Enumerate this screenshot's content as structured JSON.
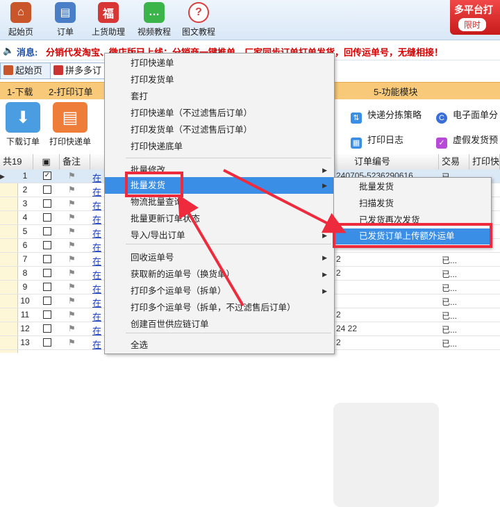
{
  "toolbar": {
    "buttons": [
      {
        "label": "起始页",
        "icon": "home-icon",
        "color": "#c9562a",
        "glyph": "⌂"
      },
      {
        "label": "订单",
        "icon": "cart-icon",
        "color": "#4a7fc8",
        "glyph": "🛒"
      },
      {
        "label": "上货助理",
        "icon": "gift-icon",
        "color": "#d83535",
        "glyph": "福"
      },
      {
        "label": "视频教程",
        "icon": "chat-icon",
        "color": "#3bb54a",
        "glyph": "…"
      },
      {
        "label": "图文教程",
        "icon": "help-icon",
        "color": "#d84040",
        "glyph": "?"
      }
    ],
    "promo_line1": "多平台打",
    "promo_line2": "限时"
  },
  "message": {
    "speaker_glyph": "🔈",
    "label": "消息:",
    "text": "分销代发淘宝、微店版已上线：分销商一键推单，厂家同步订单打单发货，回传运单号，无缝相接！"
  },
  "tabs": [
    {
      "label": "起始页"
    },
    {
      "label": "拼多多订"
    }
  ],
  "steps": [
    "1-下载",
    "2-打印订单",
    "5-功能模块"
  ],
  "functions": {
    "download_label": "下载订单",
    "print_label": "打印快递单",
    "links": [
      "快递分拣策略",
      "电子面单分",
      "打印日志",
      "虚假发货预"
    ]
  },
  "grid": {
    "headers": [
      "共19",
      "▣",
      "备注",
      "订单编号",
      "交易",
      "打印快"
    ],
    "link_text": "在",
    "rows": [
      {
        "n": "1",
        "checked": true,
        "oid": "240705-5236290616",
        "status": "已"
      },
      {
        "n": "2",
        "checked": false,
        "oid": "",
        "status": ""
      },
      {
        "n": "3",
        "checked": false,
        "oid": "",
        "status": ""
      },
      {
        "n": "4",
        "checked": false,
        "oid": "",
        "status": ""
      },
      {
        "n": "5",
        "checked": false,
        "oid": "",
        "status": ""
      },
      {
        "n": "6",
        "checked": false,
        "oid": "",
        "status": ""
      },
      {
        "n": "7",
        "checked": false,
        "oid": "2",
        "status": "已..."
      },
      {
        "n": "8",
        "checked": false,
        "oid": "2",
        "status": "已..."
      },
      {
        "n": "9",
        "checked": false,
        "oid": "",
        "status": "已..."
      },
      {
        "n": "10",
        "checked": false,
        "oid": "",
        "status": "已..."
      },
      {
        "n": "11",
        "checked": false,
        "oid": "2",
        "status": "已..."
      },
      {
        "n": "12",
        "checked": false,
        "oid": "24                    22",
        "status": "已..."
      },
      {
        "n": "13",
        "checked": false,
        "oid": "2",
        "status": "已..."
      }
    ]
  },
  "menu": {
    "items": [
      {
        "label": "打印快递单",
        "arrow": false
      },
      {
        "label": "打印发货单",
        "arrow": false
      },
      {
        "label": "套打",
        "arrow": false
      },
      {
        "label": "打印快递单（不过滤售后订单）",
        "arrow": false
      },
      {
        "label": "打印发货单（不过滤售后订单）",
        "arrow": false
      },
      {
        "label": "打印快递底单",
        "arrow": false
      },
      {
        "label": "批量修改",
        "arrow": true
      },
      {
        "label": "批量发货",
        "arrow": true,
        "highlight": true
      },
      {
        "label": "物流批量查询",
        "arrow": false
      },
      {
        "label": "批量更新订单状态",
        "arrow": false
      },
      {
        "label": "导入/导出订单",
        "arrow": true
      },
      {
        "label": "回收运单号",
        "arrow": true
      },
      {
        "label": "获取新的运单号（换货单）",
        "arrow": true
      },
      {
        "label": "打印多个运单号（拆单）",
        "arrow": true
      },
      {
        "label": "打印多个运单号（拆单，不过滤售后订单）",
        "arrow": false
      },
      {
        "label": "创建百世供应链订单",
        "arrow": false
      },
      {
        "label": "全选",
        "arrow": false
      }
    ]
  },
  "submenu": {
    "items": [
      {
        "label": "批量发货"
      },
      {
        "label": "扫描发货"
      },
      {
        "label": "已发货再次发货"
      },
      {
        "label": "已发货订单上传额外运单",
        "highlight": true
      }
    ]
  },
  "colors": {
    "accent": "#3a8ee6",
    "annotation": "#ee2b3d",
    "step_bar": "#f7c978"
  }
}
